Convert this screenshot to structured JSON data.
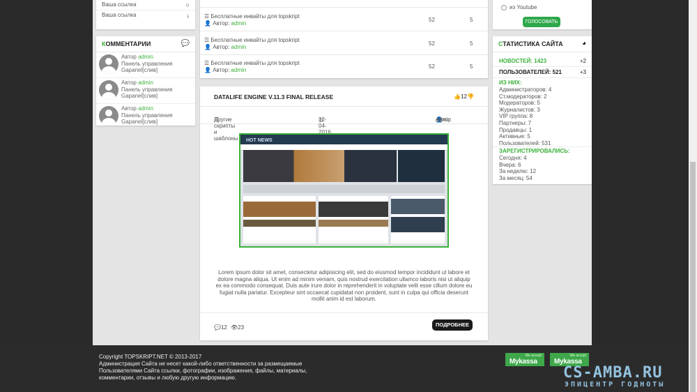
{
  "left_links": [
    {
      "label": "Ваша ссылка",
      "icon": "circle-icon"
    },
    {
      "label": "Ваша ссылка",
      "icon": "arrow-down-icon"
    }
  ],
  "comments": {
    "title": "Комментарии",
    "title_first_letter": "К",
    "title_rest": "омментарии",
    "items": [
      {
        "author_label": "Автор",
        "author": "admin",
        "line1": "Панель управления",
        "line2": "Gapanel[слив]"
      },
      {
        "author_label": "Автор",
        "author": "admin",
        "line1": "Панель управления",
        "line2": "Gapanel[слив]"
      },
      {
        "author_label": "Автор",
        "author": "admin",
        "line1": "Панель управления",
        "line2": "Gapanel[слив]"
      }
    ]
  },
  "news_rows": [
    {
      "title": "Бесплатные инвайты для topskript",
      "author_label": "Автор:",
      "author": "admin",
      "comments": "52",
      "views": "5"
    },
    {
      "title": "Бесплатные инвайты для topskript",
      "author_label": "Автор:",
      "author": "admin",
      "comments": "52",
      "views": "5"
    },
    {
      "title": "Бесплатные инвайты для topskript",
      "author_label": "Автор:",
      "author": "admin",
      "comments": "52",
      "views": "5"
    }
  ],
  "article": {
    "title": "DATALIFE ENGINE V.11.3 FINAL RELEASE",
    "likes": "12",
    "category": "Другие скрипты и шаблоны",
    "date": "12-04-2016, 19:34",
    "author_label": "Автор",
    "author": "admin",
    "image_title": "HOT NEWS",
    "text": "Lorem ipsum dolor sit amet, consectetur adipisicing elit, sed do eiusmod tempor incididunt ut labore et dolore magna aliqua. Ut enim ad minim veniam, quis nostrud exercitation ullamco laboris nisi ut aliquip ex ea commodo consequat. Duis aute irure dolor in reprehenderit in voluptate velit esse cillum dolore eu fugiat nulla pariatur. Excepteur sint occaecat cupidatat non proident, sunt in culpa qui officia deserunt mollit anim id est laborum.",
    "comments_count": "12",
    "views_count": "23",
    "more_label": "ПОДРОБНЕЕ"
  },
  "poll": {
    "option": "из Youtube",
    "vote_label": "ГОЛОСОВАТЬ"
  },
  "stats": {
    "title_first_letter": "С",
    "title_rest": "ТАТИСТИКА САЙТА",
    "news": "НОВОСТЕЙ: 1423",
    "news_plus": "+2",
    "users": "ПОЛЬЗОВАТЕЛЕЙ: 521",
    "users_plus": "+3",
    "of_them": "ИЗ НИХ:",
    "groups": [
      "Администраторов: 4",
      "Ст.модераторов: 2",
      "Модераторов: 5",
      "Журналистов: 3",
      "VIP группа: 8",
      "Партнеры: 7",
      "Продавцы: 1",
      "Активные: 5",
      "Пользователей: 531"
    ],
    "registered": "ЗАРЕГИСТРИРОВАЛИСЬ:",
    "reg": [
      "Сегодня: 4",
      "Вчера: 6",
      "За неделю: 12",
      "За месяц: 54"
    ]
  },
  "footer": {
    "copyright": "Copyright TOPSKRIPT.NET © 2013-2017",
    "disclaimer1": "Администрация Сайта не несет какой-либо ответственности за размещаемые",
    "disclaimer2": "Пользователями Сайта ссылки, фотографии, изображения, файлы, материалы,",
    "disclaimer3": "комментарии, отзывы и любую другую информацию.",
    "badge_top": "We accept",
    "badge_name": "Mykassa"
  },
  "watermark": {
    "line1": "CS-AMBA.RU",
    "line2": "ЭПИЦЕНТР ГОДНОТЫ"
  },
  "colors": {
    "accent": "#3bb03a",
    "footer": "#2b2b2b",
    "button": "#2fa84b"
  }
}
